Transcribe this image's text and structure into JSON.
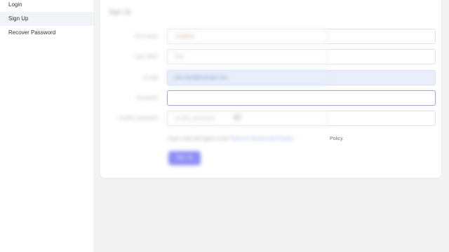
{
  "sidebar": {
    "items": [
      {
        "label": "Login"
      },
      {
        "label": "Sign Up",
        "active": true
      },
      {
        "label": "Recover Password"
      }
    ]
  },
  "form": {
    "title": "Sign Up",
    "fields": [
      {
        "label": "First name",
        "value": "Jonathan"
      },
      {
        "label": "Last name",
        "value": "Doe"
      },
      {
        "label": "E-mail",
        "value": "john.doe@example.com"
      },
      {
        "label": "Password",
        "value": ""
      },
      {
        "label": "Confirm password",
        "value": "",
        "placeholder": "Confirm password"
      }
    ],
    "policy_prefix": "I have read and agree to the",
    "policy_link": "Terms of Service and Privacy",
    "policy_suffix": "Policy.",
    "submit_label": "Sign Up"
  },
  "colors": {
    "accent": "#8c8cf5",
    "focus_border": "#b7a5d8",
    "highlight_field": "#e8eefa",
    "sidebar_active": "#f1f4f9"
  }
}
